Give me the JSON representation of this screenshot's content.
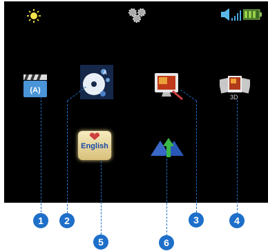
{
  "status_bar": {
    "left_icon": "sun-icon",
    "center_icon": "gears-icon",
    "right_icons": [
      "volume-icon",
      "signal-bars-icon",
      "battery-icon"
    ]
  },
  "menu": {
    "items": [
      {
        "icon": "clapperboard-icon"
      },
      {
        "icon": "disc-settings-icon"
      },
      {
        "icon": "display-settings-icon"
      },
      {
        "icon": "photo-stack-icon",
        "label": "3D"
      },
      {
        "icon": "language-icon",
        "label": "English"
      },
      {
        "icon": "upgrade-arrow-icon"
      }
    ]
  },
  "callouts": [
    "1",
    "2",
    "3",
    "4",
    "5",
    "6"
  ],
  "colors": {
    "screen": "#000000",
    "callout": "#1d6fc9",
    "leader": "#1e6fc4"
  }
}
